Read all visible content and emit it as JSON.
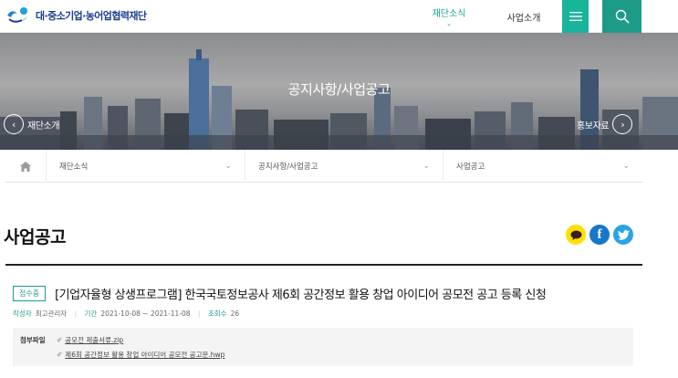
{
  "header": {
    "logo_text": "대·중소기업·농어업협력재단",
    "nav": [
      {
        "label": "재단소식",
        "active": true
      },
      {
        "label": "사업소개",
        "active": false
      }
    ],
    "icons": [
      "menu-icon",
      "search-icon"
    ],
    "colors": {
      "accent": "#18a58e",
      "brand": "#1c3f8f",
      "menu_bg": "#18b59b"
    }
  },
  "hero": {
    "title": "공지사항/사업공고",
    "prev_label": "재단소개",
    "next_label": "홍보자료"
  },
  "breadcrumb": {
    "items": [
      {
        "label": "재단소식"
      },
      {
        "label": "공지사항/사업공고"
      },
      {
        "label": "사업공고"
      }
    ]
  },
  "page": {
    "title": "사업공고",
    "share": [
      "kakao-icon",
      "facebook-icon",
      "twitter-icon"
    ]
  },
  "post": {
    "status": "접수중",
    "title": "[기업자율형 상생프로그램] 한국국토정보공사 제6회 공간정보 활용 창업 아이디어 공모전 공고 등록 신청",
    "meta": {
      "author_label": "작성자",
      "author": "최고관리자",
      "period_label": "기간",
      "period": "2021-10-08 ~ 2021-11-08",
      "views_label": "조회수",
      "views": "26"
    },
    "attachments": {
      "label": "첨부파일",
      "files": [
        {
          "name": "공모전 제출서류.zip"
        },
        {
          "name": "제6회 공간정보 활용 창업 아이디어 공모전 공고문.hwp"
        }
      ]
    }
  }
}
